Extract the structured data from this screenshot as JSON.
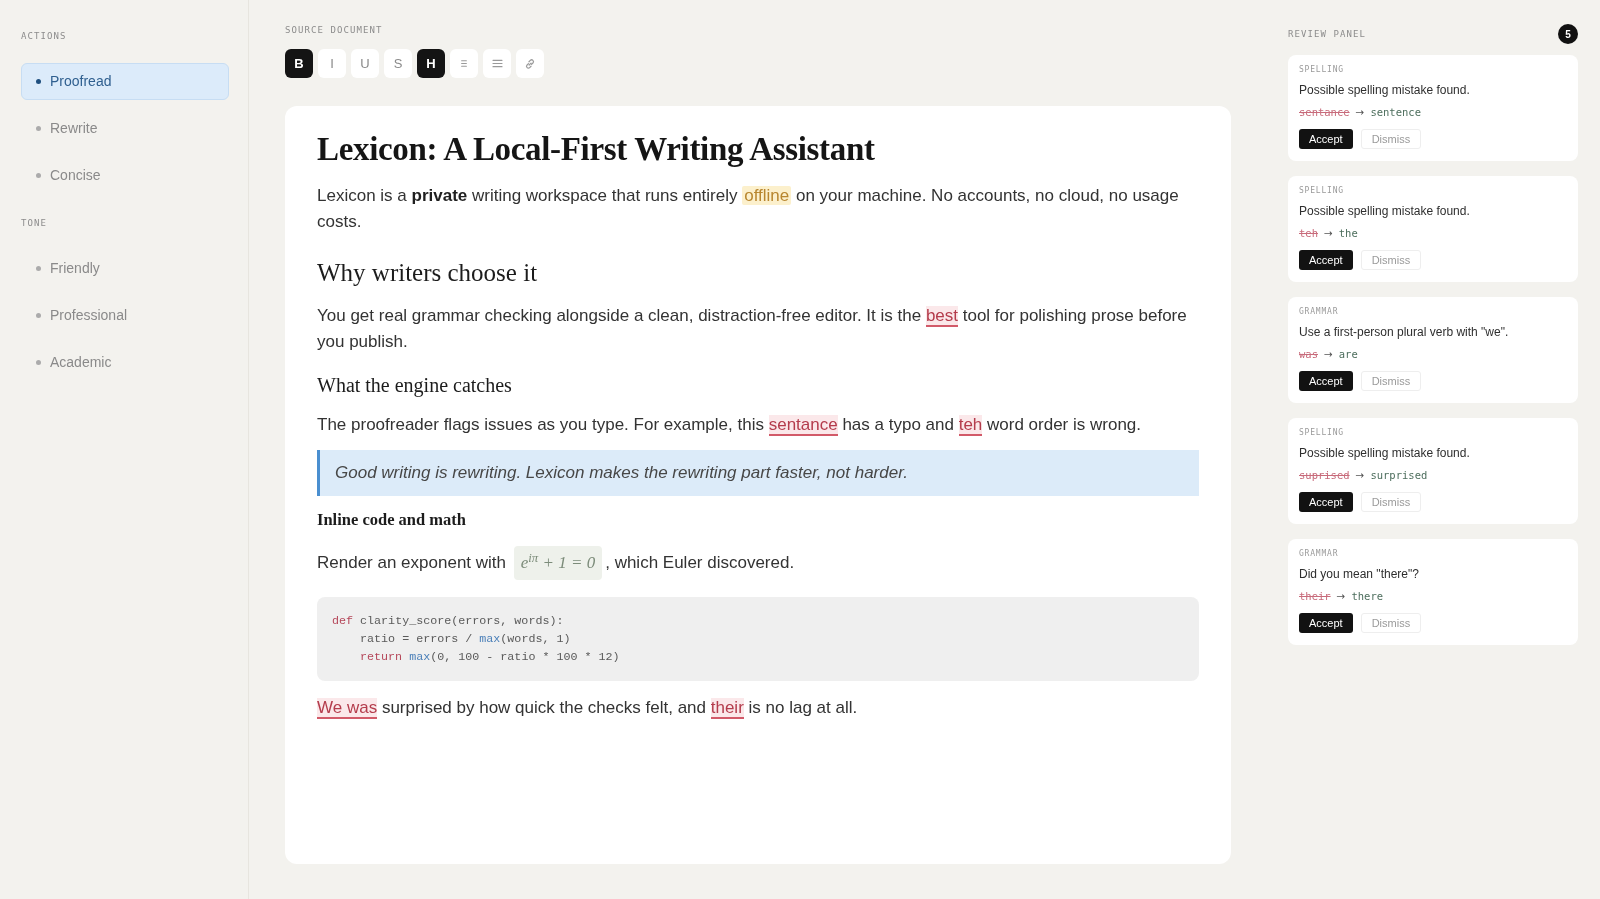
{
  "sidebar": {
    "sections": [
      {
        "title": "ACTIONS",
        "items": [
          {
            "label": "Proofread",
            "selected": true
          },
          {
            "label": "Rewrite",
            "selected": false
          },
          {
            "label": "Concise",
            "selected": false
          }
        ]
      },
      {
        "title": "TONE",
        "items": [
          {
            "label": "Friendly",
            "selected": false
          },
          {
            "label": "Professional",
            "selected": false
          },
          {
            "label": "Academic",
            "selected": false
          }
        ]
      }
    ]
  },
  "editor": {
    "label": "SOURCE DOCUMENT",
    "toolbar": {
      "format_buttons": [
        {
          "label": "B",
          "active": true
        },
        {
          "label": "I",
          "active": false
        },
        {
          "label": "U",
          "active": false
        },
        {
          "label": "S",
          "active": false
        },
        {
          "label": "H",
          "active": true
        }
      ],
      "tool_buttons": [
        {
          "active": false
        },
        {
          "active": false
        },
        {
          "active": false
        }
      ]
    },
    "blocks": [
      {
        "kind": "h1",
        "text": "Lexicon: A Local-First Writing Assistant"
      },
      {
        "kind": "p",
        "runs": [
          {
            "kind": "plain",
            "text": "Lexicon is a "
          },
          {
            "kind": "bold",
            "text": "private"
          },
          {
            "kind": "plain",
            "text": " writing workspace that runs entirely "
          },
          {
            "kind": "highlight",
            "text": "offline"
          },
          {
            "kind": "plain",
            "text": " on your machine. No accounts, no cloud, no usage costs."
          }
        ]
      },
      {
        "kind": "h2",
        "text": "Why writers choose it"
      },
      {
        "kind": "p",
        "runs": [
          {
            "kind": "plain",
            "text": "You get real grammar checking alongside a clean, distraction-free editor. It is the "
          },
          {
            "kind": "flag",
            "text": "best"
          },
          {
            "kind": "plain",
            "text": " tool for polishing prose before you publish."
          }
        ]
      },
      {
        "kind": "h3",
        "text": "What the engine catches"
      },
      {
        "kind": "p",
        "runs": [
          {
            "kind": "plain",
            "text": "The proofreader flags issues as you type. For example, this "
          },
          {
            "kind": "flag",
            "text": "sentance"
          },
          {
            "kind": "plain",
            "text": " has a typo and "
          },
          {
            "kind": "flag",
            "text": "teh"
          },
          {
            "kind": "plain",
            "text": " word order is wrong."
          }
        ]
      },
      {
        "kind": "quote",
        "text": "Good writing is rewriting. Lexicon makes the rewriting part faster, not harder."
      },
      {
        "kind": "h4",
        "text": "Inline code and math"
      },
      {
        "kind": "p",
        "runs": [
          {
            "kind": "plain",
            "text": "Render an exponent with "
          },
          {
            "kind": "math",
            "text": "e$^{iπ}$ + 1 = 0"
          },
          {
            "kind": "plain",
            "text": ", which Euler discovered."
          }
        ]
      },
      {
        "kind": "code",
        "lines": [
          [
            {
              "kind": "keyword",
              "text": "def"
            },
            {
              "kind": "plain",
              "text": " clarity_score(errors, words):"
            }
          ],
          [
            {
              "kind": "plain",
              "text": "    ratio = errors / "
            },
            {
              "kind": "builtin",
              "text": "max"
            },
            {
              "kind": "plain",
              "text": "(words, 1)"
            }
          ],
          [
            {
              "kind": "keyword",
              "text": "    return"
            },
            {
              "kind": "builtin",
              "text": " max"
            },
            {
              "kind": "plain",
              "text": "(0, 100 - ratio * 100 * 12)"
            }
          ]
        ]
      },
      {
        "kind": "p",
        "runs": [
          {
            "kind": "flag",
            "text": "We was"
          },
          {
            "kind": "plain",
            "text": " surprised by how quick the checks felt, and "
          },
          {
            "kind": "flag",
            "text": "their"
          },
          {
            "kind": "plain",
            "text": " is no lag at all."
          }
        ]
      }
    ]
  },
  "review_panel": {
    "title": "REVIEW PANEL",
    "count": "5",
    "cards": [
      {
        "category": "SPELLING",
        "message": "Possible spelling mistake found.",
        "original": "sentance",
        "arrow": "→",
        "suggestion": "sentence",
        "accept": "Accept",
        "dismiss": "Dismiss"
      },
      {
        "category": "SPELLING",
        "message": "Possible spelling mistake found.",
        "original": "teh",
        "arrow": "→",
        "suggestion": "the",
        "accept": "Accept",
        "dismiss": "Dismiss"
      },
      {
        "category": "GRAMMAR",
        "message": "Use a first-person plural verb with \"we\".",
        "original": "was",
        "arrow": "→",
        "suggestion": "are",
        "accept": "Accept",
        "dismiss": "Dismiss"
      },
      {
        "category": "SPELLING",
        "message": "Possible spelling mistake found.",
        "original": "suprised",
        "arrow": "→",
        "suggestion": "surprised",
        "accept": "Accept",
        "dismiss": "Dismiss"
      },
      {
        "category": "GRAMMAR",
        "message": "Did you mean \"there\"?",
        "original": "their",
        "arrow": "→",
        "suggestion": "there",
        "accept": "Accept",
        "dismiss": "Dismiss"
      }
    ]
  }
}
